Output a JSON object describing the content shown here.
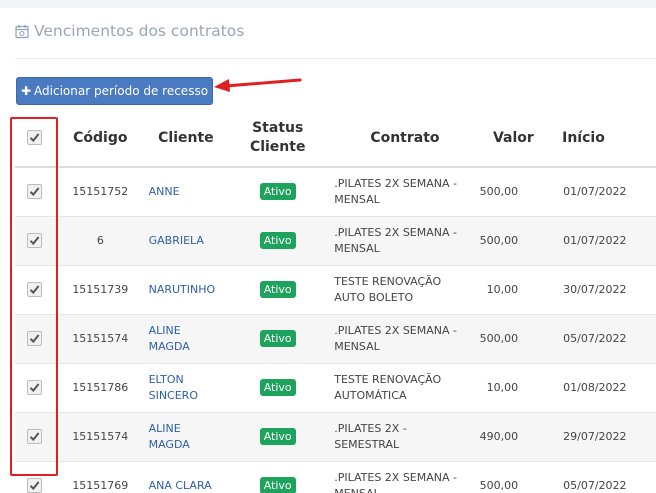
{
  "section": {
    "title": "Vencimentos dos contratos",
    "icon": "calendar-icon"
  },
  "add_button": {
    "label": "Adicionar período de recesso",
    "icon": "plus-icon"
  },
  "annotation_color": "#e02020",
  "table": {
    "headers": {
      "codigo": "Código",
      "cliente": "Cliente",
      "status_line1": "Status",
      "status_line2": "Cliente",
      "contrato": "Contrato",
      "valor": "Valor",
      "inicio": "Início"
    },
    "rows": [
      {
        "checked": true,
        "codigo": "15151752",
        "cliente_l1": "ANNE",
        "cliente_l2": "",
        "status": "Ativo",
        "contrato_l1": ".PILATES 2X SEMANA -",
        "contrato_l2": "MENSAL",
        "valor": "500,00",
        "inicio": "01/07/2022"
      },
      {
        "checked": true,
        "codigo": "6",
        "cliente_l1": "GABRIELA",
        "cliente_l2": "",
        "status": "Ativo",
        "contrato_l1": ".PILATES 2X SEMANA -",
        "contrato_l2": "MENSAL",
        "valor": "500,00",
        "inicio": "01/07/2022"
      },
      {
        "checked": true,
        "codigo": "15151739",
        "cliente_l1": "NARUTINHO",
        "cliente_l2": "",
        "status": "Ativo",
        "contrato_l1": "TESTE RENOVAÇÃO",
        "contrato_l2": "AUTO BOLETO",
        "valor": "10,00",
        "inicio": "30/07/2022"
      },
      {
        "checked": true,
        "codigo": "15151574",
        "cliente_l1": "ALINE MAGDA",
        "cliente_l2": "",
        "status": "Ativo",
        "contrato_l1": ".PILATES 2X SEMANA -",
        "contrato_l2": "MENSAL",
        "valor": "500,00",
        "inicio": "05/07/2022"
      },
      {
        "checked": true,
        "codigo": "15151786",
        "cliente_l1": "ELTON",
        "cliente_l2": "SINCERO",
        "status": "Ativo",
        "contrato_l1": "TESTE RENOVAÇÃO",
        "contrato_l2": "AUTOMÁTICA",
        "valor": "10,00",
        "inicio": "01/08/2022"
      },
      {
        "checked": true,
        "codigo": "15151574",
        "cliente_l1": "ALINE MAGDA",
        "cliente_l2": "",
        "status": "Ativo",
        "contrato_l1": ".PILATES 2X -",
        "contrato_l2": "SEMESTRAL",
        "valor": "490,00",
        "inicio": "29/07/2022"
      },
      {
        "checked": true,
        "codigo": "15151769",
        "cliente_l1": "ANA CLARA",
        "cliente_l2": "",
        "status": "Ativo",
        "contrato_l1": ".PILATES 2X SEMANA -",
        "contrato_l2": "MENSAL",
        "valor": "500,00",
        "inicio": "05/07/2022"
      }
    ]
  }
}
